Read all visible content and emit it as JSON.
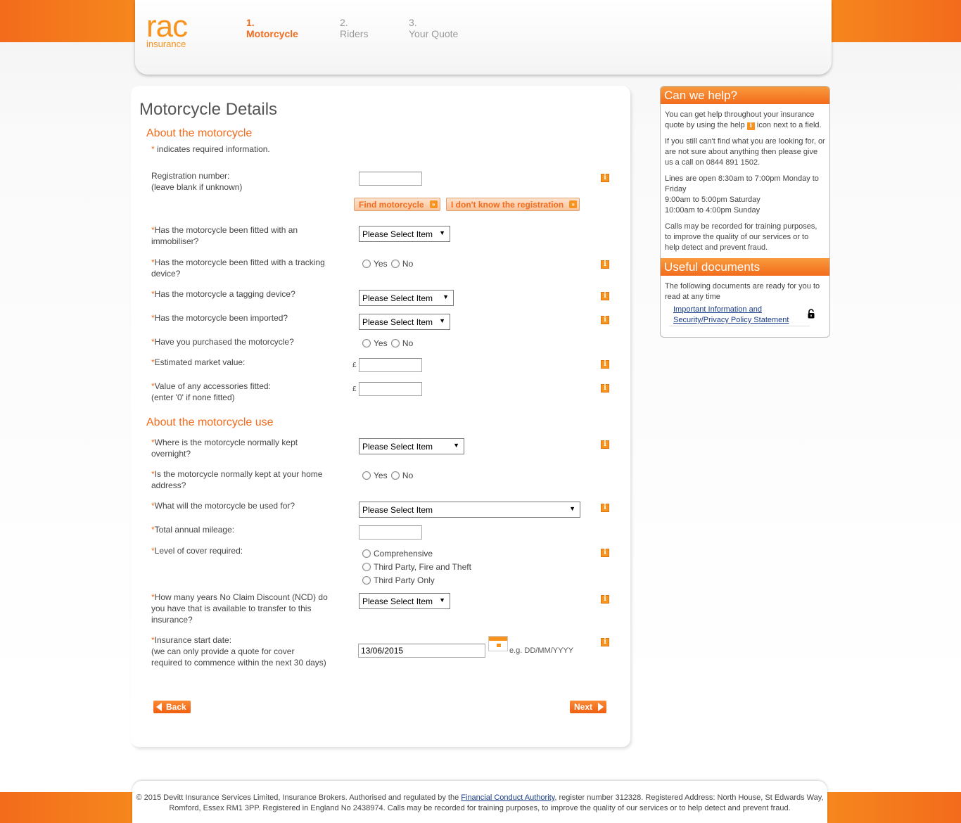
{
  "header": {
    "logo_main": "rac",
    "logo_sub": "insurance",
    "steps": [
      {
        "num": "1.",
        "label": "Motorcycle"
      },
      {
        "num": "2.",
        "label": "Riders"
      },
      {
        "num": "3.",
        "label": "Your Quote"
      }
    ]
  },
  "main": {
    "title": "Motorcycle Details",
    "section1": "About the motorcycle",
    "required_star": "*",
    "required_note": " indicates required information.",
    "section2": "About the motorcycle use",
    "star": "*",
    "info_glyph": "i",
    "yes": "Yes",
    "no": "No",
    "pound": "£",
    "select_placeholder": "Please Select Item",
    "select_arrow": "▼",
    "fields": {
      "registration": "Registration number:\n(leave blank if unknown)",
      "immobiliser": "Has the motorcycle been fitted with an immobiliser?",
      "tracking": "Has the motorcycle been fitted with a tracking device?",
      "tagging": "Has the motorcycle a tagging device?",
      "imported": "Has the motorcycle been imported?",
      "purchased": "Have you purchased the motorcycle?",
      "market_value": "Estimated market value:",
      "accessories": "Value of any accessories fitted:",
      "accessories_hint": "(enter '0' if none fitted)",
      "kept_overnight": "Where is the motorcycle normally kept overnight?",
      "kept_home": "Is the motorcycle normally kept at your home address?",
      "used_for": "What will the motorcycle be used for?",
      "mileage": "Total annual mileage:",
      "cover": "Level of cover required:",
      "ncd": "How many years No Claim Discount (NCD) do you have that is available to transfer to this insurance?",
      "start_date": "Insurance start date:",
      "start_date_hint": "(we can only provide a quote for cover required to commence within the next 30 days)"
    },
    "cover_options": [
      "Comprehensive",
      "Third Party, Fire and Theft",
      "Third Party Only"
    ],
    "start_date_value": "13/06/2015",
    "date_example": "e.g. DD/MM/YYYY",
    "buttons": {
      "find": "Find motorcycle",
      "dont_know": "I don't know the registration",
      "back": "Back",
      "next": "Next",
      "arrow": "»"
    }
  },
  "sidebar": {
    "help_title": "Can we help?",
    "help_p1_a": "You can get help throughout your insurance quote by using the help ",
    "help_p1_b": " icon next to a field.",
    "help_p2": "If you still can't find what you are looking for, or are not sure about anything then please give us a call on 0844 891 1502.",
    "help_p3_l1": "Lines are open 8:30am to 7:00pm Monday to Friday",
    "help_p3_l2": "9:00am to 5:00pm Saturday",
    "help_p3_l3": "10:00am to 4:00pm Sunday",
    "help_p4": "Calls may be recorded for training purposes, to improve the quality of our services or to help detect and prevent fraud.",
    "docs_title": "Useful documents",
    "docs_intro": "The following documents are ready for you to read at any time",
    "doc_link": "Important Information and Security/Privacy Policy Statement"
  },
  "footer": {
    "text_a": "© 2015 Devitt Insurance Services Limited, Insurance Brokers. Authorised and regulated by the ",
    "fca_link": "Financial Conduct Authority",
    "text_b": ", register number 312328. Registered Address: North House, St Edwards Way, Romford, Essex RM1 3PP. Registered in England No 2438974. Calls may be recorded for training purposes, to improve the quality of our services or to help detect and prevent fraud."
  },
  "colors": {
    "brand_orange": "#f7931e",
    "accent_orange": "#f36b1c",
    "link_blue": "#1a3c8c"
  }
}
